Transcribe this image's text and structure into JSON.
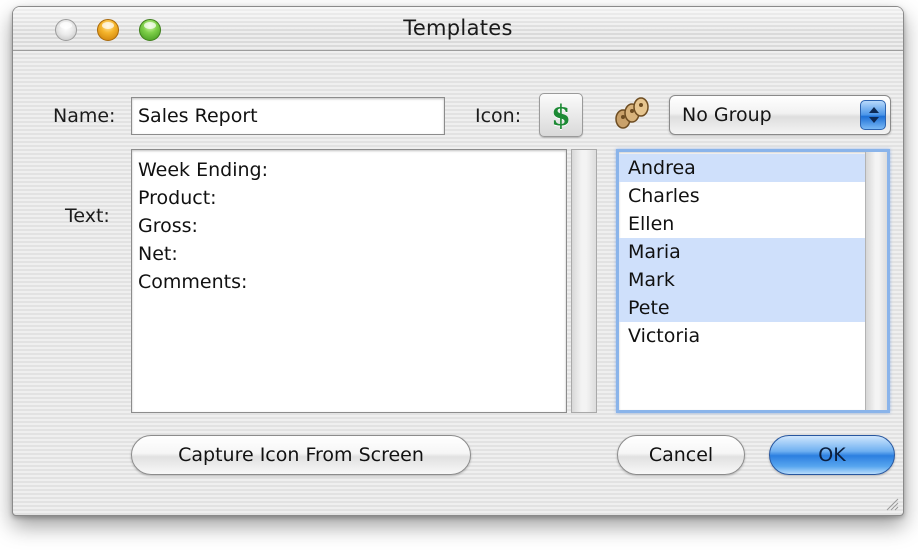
{
  "window": {
    "title": "Templates"
  },
  "form": {
    "name_label": "Name:",
    "name_value": "Sales Report",
    "icon_label": "Icon:",
    "icon_glyph": "$",
    "icon_semantic": "dollar-sign-icon",
    "group_icon_semantic": "group-users-icon",
    "group_select_value": "No Group",
    "text_label": "Text:",
    "text_lines": [
      "Week Ending:",
      "Product:",
      "Gross:",
      "Net:",
      "Comments:"
    ]
  },
  "people_list": {
    "items": [
      {
        "label": "Andrea",
        "selected": true
      },
      {
        "label": "Charles",
        "selected": false
      },
      {
        "label": "Ellen",
        "selected": false
      },
      {
        "label": "Maria",
        "selected": true
      },
      {
        "label": "Mark",
        "selected": true
      },
      {
        "label": "Pete",
        "selected": true
      },
      {
        "label": "Victoria",
        "selected": false
      }
    ]
  },
  "buttons": {
    "capture_label": "Capture Icon From Screen",
    "cancel_label": "Cancel",
    "ok_label": "OK"
  },
  "colors": {
    "selection": "#cfe0fb",
    "default_button": "#2c7fe0",
    "focus_ring": "#8ab4ea",
    "icon_green": "#1d8a35"
  }
}
